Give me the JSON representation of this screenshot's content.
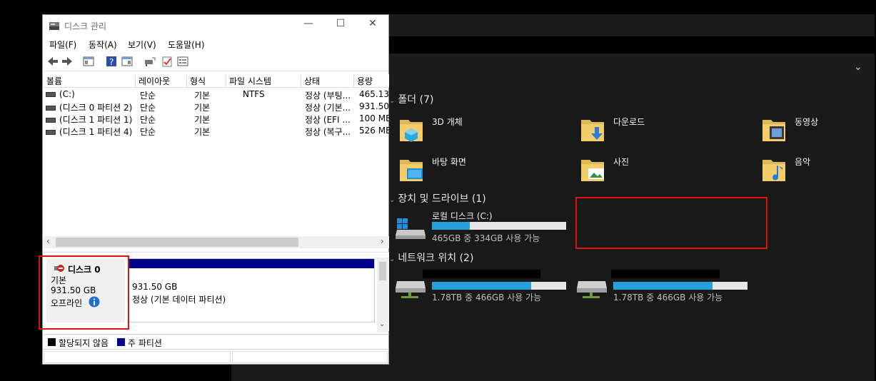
{
  "colors": {
    "accent": "#26a0da",
    "primary_partition": "#00008b",
    "highlight": "#e01010"
  },
  "explorer": {
    "folders_header": "폴더 (7)",
    "folders": [
      {
        "label": "3D 개체",
        "icon": "3d-objects-folder-icon"
      },
      {
        "label": "다운로드",
        "icon": "downloads-folder-icon"
      },
      {
        "label": "동영상",
        "icon": "videos-folder-icon"
      },
      {
        "label": "바탕 화면",
        "icon": "desktop-folder-icon"
      },
      {
        "label": "사진",
        "icon": "pictures-folder-icon"
      },
      {
        "label": "음악",
        "icon": "music-folder-icon"
      }
    ],
    "devices_header": "장치 및 드라이브 (1)",
    "local_disk": {
      "label": "로컬 디스크 (C:)",
      "free": "465GB 중 334GB 사용 가능",
      "used_fraction": 0.28
    },
    "network_header": "네트워크 위치 (2)",
    "network": [
      {
        "free": "1.78TB 중 466GB 사용 가능",
        "used_fraction": 0.74
      },
      {
        "free": "1.78TB 중 466GB 사용 가능",
        "used_fraction": 0.74
      }
    ]
  },
  "dm": {
    "title": "디스크 관리",
    "menu": [
      "파일(F)",
      "동작(A)",
      "보기(V)",
      "도움말(H)"
    ],
    "columns": [
      "볼륨",
      "레이아웃",
      "형식",
      "파일 시스템",
      "상태",
      "용량"
    ],
    "rows": [
      {
        "volume": "(C:)",
        "layout": "단순",
        "type": "기본",
        "fs": "NTFS",
        "status": "정상 (부팅...",
        "capacity": "465.13"
      },
      {
        "volume": "(디스크 0 파티션 2)",
        "layout": "단순",
        "type": "기본",
        "fs": "",
        "status": "정상 (기본...",
        "capacity": "931.50"
      },
      {
        "volume": "(디스크 1 파티션 1)",
        "layout": "단순",
        "type": "기본",
        "fs": "",
        "status": "정상 (EFI ...",
        "capacity": "100 ME"
      },
      {
        "volume": "(디스크 1 파티션 4)",
        "layout": "단순",
        "type": "기본",
        "fs": "",
        "status": "정상 (복구...",
        "capacity": "526 ME"
      }
    ],
    "disk": {
      "name": "디스크 0",
      "kind": "기본",
      "size": "931.50 GB",
      "state": "오프라인"
    },
    "partition": {
      "size": "931.50 GB",
      "status": "정상 (기본 데이터 파티션)"
    },
    "legend": {
      "unallocated": "할당되지 않음",
      "primary": "주 파티션"
    }
  }
}
